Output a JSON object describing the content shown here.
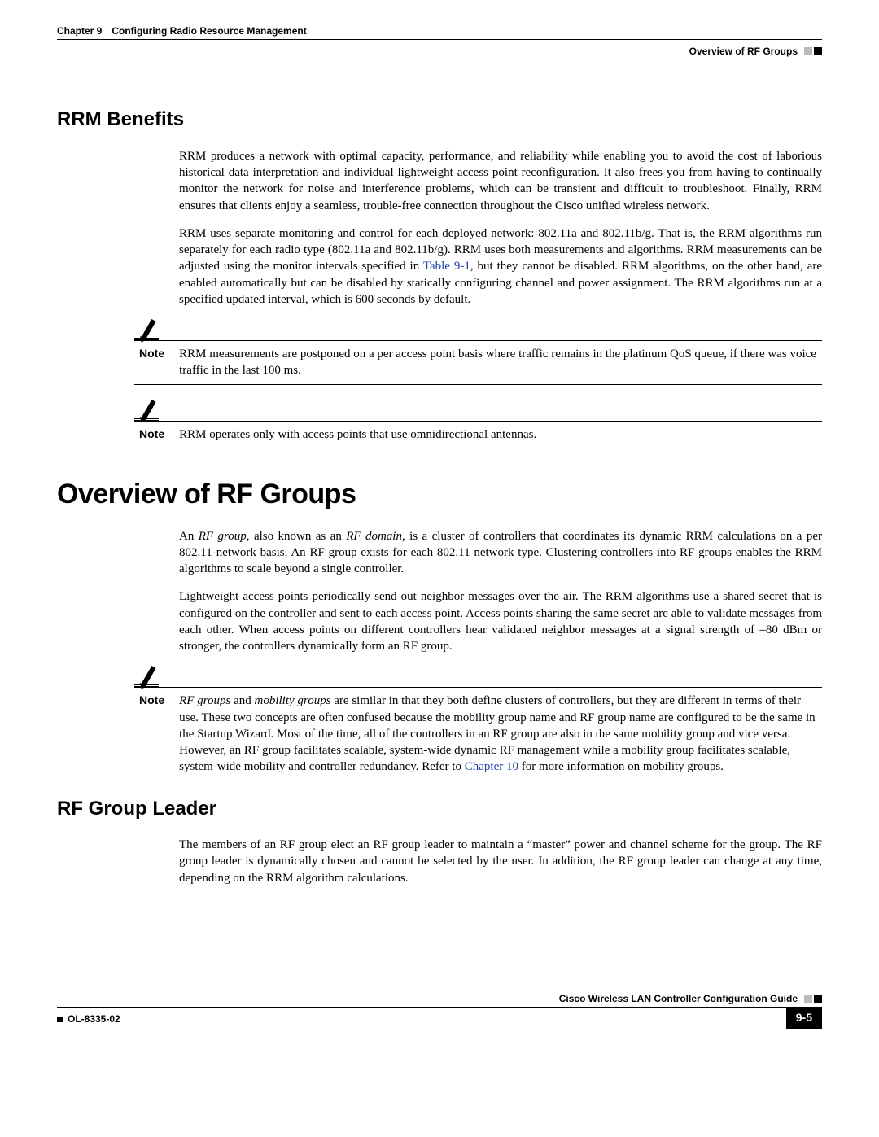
{
  "header": {
    "chapter_label": "Chapter 9",
    "chapter_title": "Configuring Radio Resource Management",
    "section_title": "Overview of RF Groups"
  },
  "sections": {
    "rrm_benefits": {
      "heading": "RRM Benefits",
      "p1": "RRM produces a network with optimal capacity, performance, and reliability while enabling you to avoid the cost of laborious historical data interpretation and individual lightweight access point reconfiguration. It also frees you from having to continually monitor the network for noise and interference problems, which can be transient and difficult to troubleshoot. Finally, RRM ensures that clients enjoy a seamless, trouble-free connection throughout the Cisco unified wireless network.",
      "p2_pre": "RRM uses separate monitoring and control for each deployed network: 802.11a and 802.11b/g. That is, the RRM algorithms run separately for each radio type (802.11a and 802.11b/g). RRM uses both measurements and algorithms. RRM measurements can be adjusted using the monitor intervals specified in ",
      "p2_link": "Table 9-1",
      "p2_post": ", but they cannot be disabled. RRM algorithms, on the other hand, are enabled automatically but can be disabled by statically configuring channel and power assignment. The RRM algorithms run at a specified updated interval, which is 600 seconds by default.",
      "note1_label": "Note",
      "note1_text": "RRM measurements are postponed on a per access point basis where traffic remains in the platinum QoS queue, if there was voice traffic in the last 100 ms.",
      "note2_label": "Note",
      "note2_text": "RRM operates only with access points that use omnidirectional antennas."
    },
    "overview": {
      "heading": "Overview of RF Groups",
      "p1_pre": "An ",
      "p1_em1": "RF group",
      "p1_mid1": ", also known as an ",
      "p1_em2": "RF domain",
      "p1_post": ", is a cluster of controllers that coordinates its dynamic RRM calculations on a per 802.11-network basis. An RF group exists for each 802.11 network type. Clustering controllers into RF groups enables the RRM algorithms to scale beyond a single controller.",
      "p2": "Lightweight access points periodically send out neighbor messages over the air. The RRM algorithms use a shared secret that is configured on the controller and sent to each access point. Access points sharing the same secret are able to validate messages from each other. When access points on different controllers hear validated neighbor messages at a signal strength of –80 dBm or stronger, the controllers dynamically form an RF group.",
      "note_label": "Note",
      "note_em1": "RF groups",
      "note_mid1": " and ",
      "note_em2": "mobility groups",
      "note_mid2": " are similar in that they both define clusters of controllers, but they are different in terms of their use. These two concepts are often confused because the mobility group name and RF group name are configured to be the same in the Startup Wizard. Most of the time, all of the controllers in an RF group are also in the same mobility group and vice versa. However, an RF group facilitates scalable, system-wide dynamic RF management while a mobility group facilitates scalable, system-wide mobility and controller redundancy. Refer to ",
      "note_link": "Chapter 10",
      "note_post": " for more information on mobility groups."
    },
    "leader": {
      "heading": "RF Group Leader",
      "p1": "The members of an RF group elect an RF group leader to maintain a “master” power and channel scheme for the group. The RF group leader is dynamically chosen and cannot be selected by the user. In addition, the RF group leader can change at any time, depending on the RRM algorithm calculations."
    }
  },
  "footer": {
    "guide_title": "Cisco Wireless LAN Controller Configuration Guide",
    "doc_id": "OL-8335-02",
    "page_number": "9-5"
  }
}
